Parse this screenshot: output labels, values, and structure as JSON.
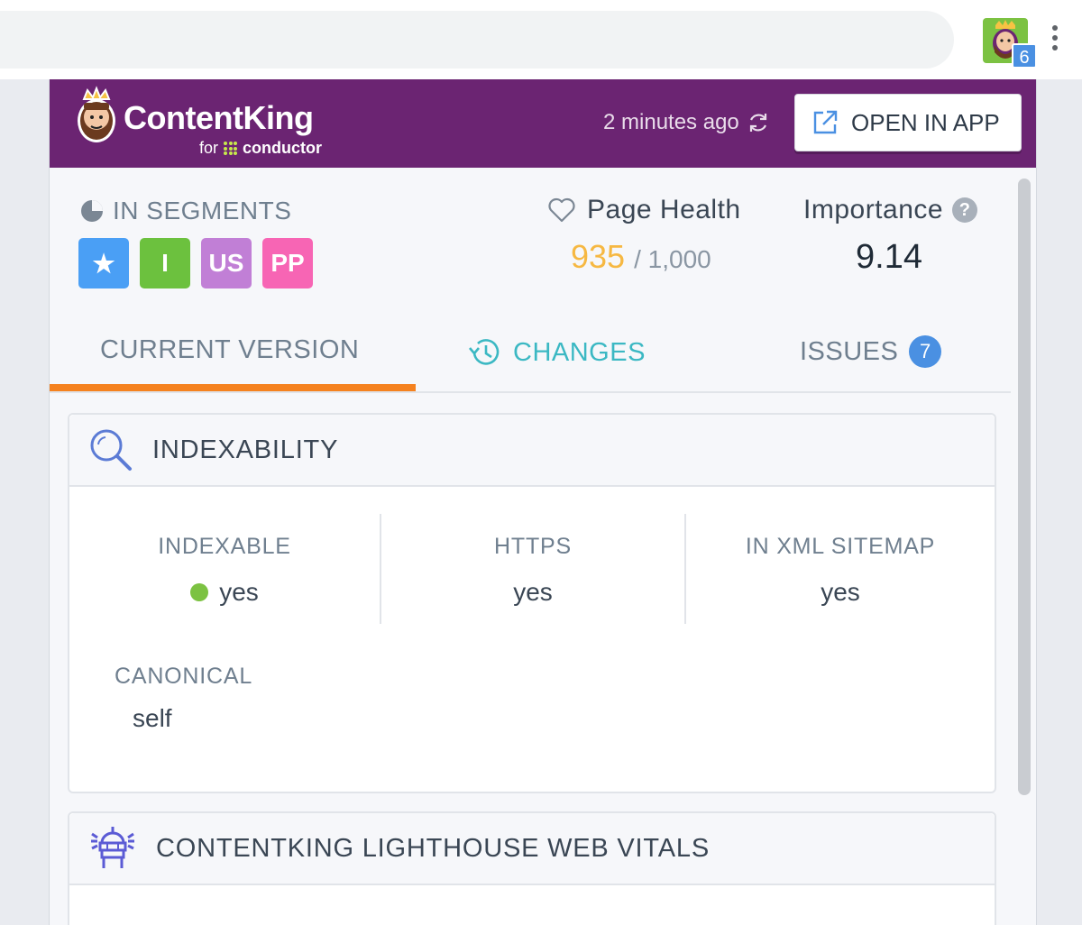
{
  "browser": {
    "extension_badge_count": "6"
  },
  "header": {
    "logo_text": "ContentKing",
    "logo_sub_prefix": "for",
    "logo_sub_brand": "conductor",
    "updated": "2 minutes ago",
    "open_button": "OPEN IN APP"
  },
  "segments": {
    "title": "IN SEGMENTS",
    "items": [
      {
        "label": "★",
        "color": "#4a9ff5"
      },
      {
        "label": "I",
        "color": "#6cc13e"
      },
      {
        "label": "US",
        "color": "#c17fd6"
      },
      {
        "label": "PP",
        "color": "#f765b4"
      }
    ]
  },
  "page_health": {
    "label": "Page Health",
    "value": "935",
    "max": "/ 1,000"
  },
  "importance": {
    "label": "Importance",
    "help": "?",
    "value": "9.14"
  },
  "tabs": {
    "current": "CURRENT VERSION",
    "changes": "CHANGES",
    "issues": "ISSUES",
    "issues_count": "7"
  },
  "indexability": {
    "title": "INDEXABILITY",
    "indexable_label": "INDEXABLE",
    "indexable_value": "yes",
    "https_label": "HTTPS",
    "https_value": "yes",
    "sitemap_label": "IN XML SITEMAP",
    "sitemap_value": "yes",
    "canonical_label": "CANONICAL",
    "canonical_value": "self"
  },
  "lighthouse": {
    "title": "CONTENTKING LIGHTHOUSE WEB VITALS"
  },
  "colors": {
    "header_bg": "#6b2472",
    "accent_orange": "#f5821f",
    "accent_teal": "#3bb8c3",
    "health_value": "#f6b842"
  }
}
